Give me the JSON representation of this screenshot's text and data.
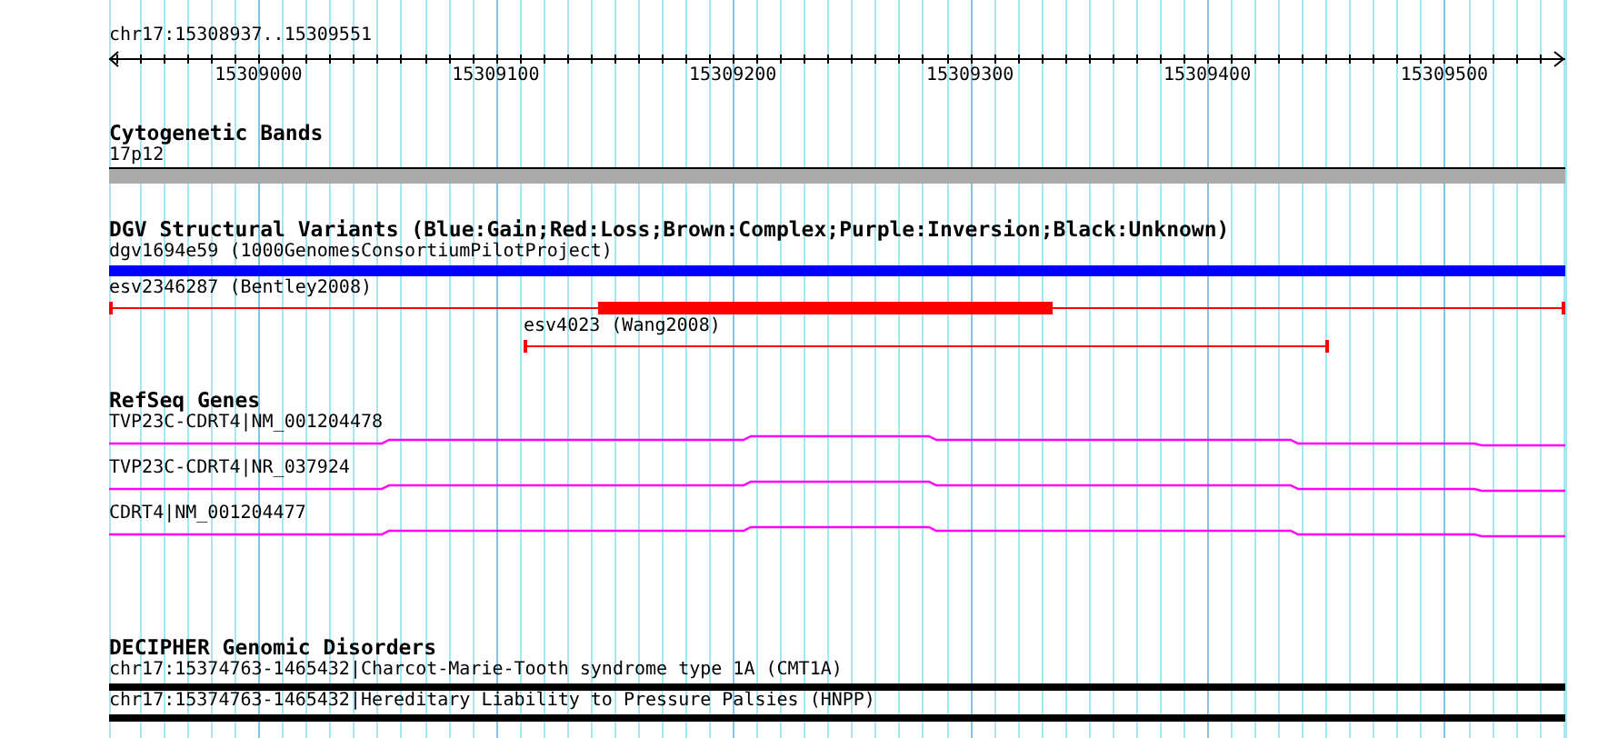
{
  "ruler": {
    "range": "chr17:15308937..15309551",
    "ticks": [
      "15309000",
      "15309100",
      "15309200",
      "15309300",
      "15309400",
      "15309500"
    ]
  },
  "tracks": [
    {
      "title": "Cytogenetic Bands",
      "kind": "band",
      "features": [
        {
          "label": "17p12",
          "color": "#aaaaaa"
        }
      ]
    },
    {
      "title": "DGV Structural Variants (Blue:Gain;Red:Loss;Brown:Complex;Purple:Inversion;Black:Unknown)",
      "kind": "variant",
      "features": [
        {
          "label": "dgv1694e59 (1000GenomesConsortiumPilotProject)",
          "color": "#0000ff"
        },
        {
          "label": "esv2346287 (Bentley2008)",
          "color": "#ff0000"
        },
        {
          "label": "esv4023 (Wang2008)",
          "color": "#ff0000"
        }
      ]
    },
    {
      "title": "RefSeq Genes",
      "kind": "gene",
      "features": [
        {
          "label": "TVP23C-CDRT4|NM_001204478",
          "color": "#ff00ff"
        },
        {
          "label": "TVP23C-CDRT4|NR_037924",
          "color": "#ff00ff"
        },
        {
          "label": "CDRT4|NM_001204477",
          "color": "#ff00ff"
        }
      ]
    },
    {
      "title": "DECIPHER Genomic Disorders",
      "kind": "region",
      "features": [
        {
          "label": "chr17:15374763-1465432|Charcot-Marie-Tooth syndrome type 1A (CMT1A)",
          "color": "#000000"
        },
        {
          "label": "chr17:15374763-1465432|Hereditary Liability to Pressure Palsies (HNPP)",
          "color": "#000000"
        }
      ]
    }
  ]
}
